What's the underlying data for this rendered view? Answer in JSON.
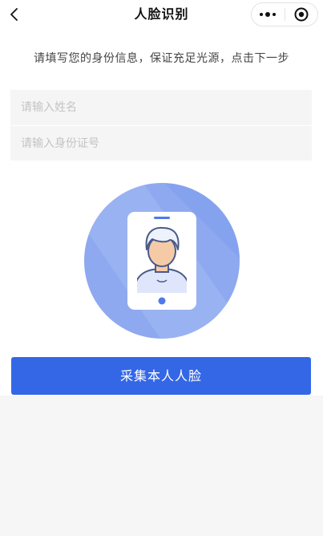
{
  "navbar": {
    "title": "人脸识别",
    "back_icon": "chevron-left-icon",
    "more_icon": "more-dots-icon",
    "close_icon": "target-circle-icon"
  },
  "instruction": "请填写您的身份信息，保证充足光源，点击下一步",
  "form": {
    "name_placeholder": "请输入姓名",
    "name_value": "",
    "id_placeholder": "请输入身份证号",
    "id_value": ""
  },
  "illustration": {
    "icon": "phone-face-avatar-icon"
  },
  "capture_button": {
    "label": "采集本人人脸"
  },
  "colors": {
    "accent": "#3467e6",
    "circle": "#8ea9f0",
    "input_bg": "#f5f5f6",
    "page_bg": "#f6f6f6"
  }
}
